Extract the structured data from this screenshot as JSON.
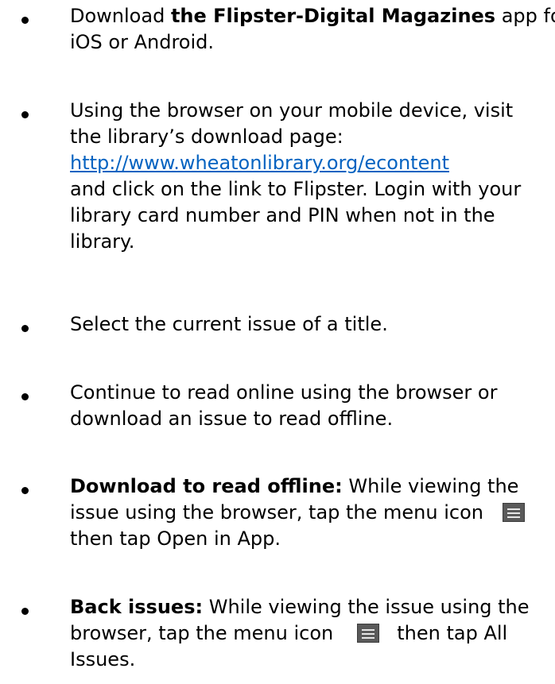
{
  "items": [
    {
      "lines": [
        [
          "Download ",
          "the Flipster-Digital Magazines",
          " app for"
        ],
        [
          "iOS or Android."
        ]
      ]
    },
    {
      "lines": [
        [
          "Using the browser on your mobile device, visit"
        ],
        [
          "the library’s download page:"
        ],
        [
          "http://www.wheatonlibrary.org/econtent"
        ],
        [
          "and click on the link to Flipster.  Login with your"
        ],
        [
          "library card number and PIN when not in the"
        ],
        [
          "library."
        ]
      ]
    },
    {
      "lines": [
        [
          "Select the current issue of a title."
        ]
      ]
    },
    {
      "lines": [
        [
          "Continue to read online using the browser or"
        ],
        [
          "download an issue to read offline."
        ]
      ]
    },
    {
      "lines": [
        [
          "Download to read offline:",
          "  While viewing the"
        ],
        [
          "issue using the browser, tap the menu icon"
        ],
        [
          "then tap Open in App."
        ]
      ]
    },
    {
      "lines": [
        [
          "Back issues:",
          "  While viewing the issue using the"
        ],
        [
          "browser, tap the menu icon",
          "then tap All"
        ],
        [
          "Issues."
        ]
      ]
    }
  ],
  "icons": {
    "menu_icon": "menu-icon",
    "bullet_icon": "bullet-icon"
  },
  "colors": {
    "link": "#0563c1",
    "text": "#000000",
    "menu_icon_bg": "#5a5a5a"
  }
}
